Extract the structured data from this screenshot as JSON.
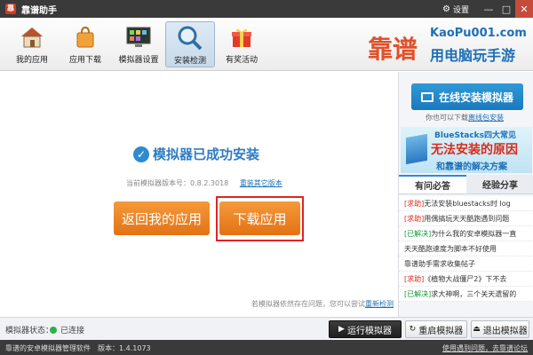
{
  "window": {
    "title": "靠谱助手",
    "settings_label": "设置"
  },
  "toolbar": {
    "items": [
      {
        "label": "我的应用",
        "icon": "house-icon"
      },
      {
        "label": "应用下载",
        "icon": "shopping-bag-icon"
      },
      {
        "label": "模拟器设置",
        "icon": "monitor-grid-icon"
      },
      {
        "label": "安装检测",
        "icon": "magnifier-icon",
        "active": true
      },
      {
        "label": "有奖活动",
        "icon": "gift-icon"
      }
    ]
  },
  "brand": {
    "logo_text": "靠谱",
    "site": "KaoPu001.com",
    "slogan": "用电脑玩手游"
  },
  "main": {
    "success_text": "模拟器已成功安装",
    "version_prefix": "当前模拟器版本号：",
    "version": "0.8.2.3018",
    "reinstall_link": "重装其它版本",
    "back_button": "返回我的应用",
    "download_button": "下载应用",
    "problem_text": "若模拟器依然存在问题，您可以尝试",
    "redetect_link": "重新检测"
  },
  "side": {
    "online_install_button": "在线安装模拟器",
    "online_hint": "你也可以下载",
    "offline_link": "离线包安装",
    "banner": {
      "line1": "BlueStacks四大常见",
      "line2": "无法安装的原因",
      "line3": "和靠谱的解决方案"
    },
    "tabs": [
      "有问必答",
      "经验分享"
    ],
    "news": [
      {
        "tag": "[求助]",
        "type": "q",
        "text": "无法安装bluestacks时 log"
      },
      {
        "tag": "[求助]",
        "type": "q",
        "text": "用偶搞玩天天酷跑遇到问题"
      },
      {
        "tag": "[已解决]",
        "type": "s",
        "text": "为什么我的安卓模拟器一直"
      },
      {
        "tag": "",
        "type": "n",
        "text": "天天酷跑速度为脚本不好使用"
      },
      {
        "tag": "",
        "type": "n",
        "text": "靠谱助手需求收集帖子"
      },
      {
        "tag": "[求助]",
        "type": "q",
        "text": "《植物大战僵尸2》下不去"
      },
      {
        "tag": "[已解决]",
        "type": "s",
        "text": "求大神啊，三个关天遗留的"
      }
    ]
  },
  "statusbar": {
    "label": "模拟器状态：",
    "status": "已连接",
    "run_button": "运行模拟器",
    "restart_button": "重启模拟器",
    "exit_button": "退出模拟器"
  },
  "bottombar": {
    "left": "靠谱的安卓模拟器管理软件",
    "version": "版本：1.4.1073",
    "right": "使用遇到问题，去靠谱论坛"
  },
  "colors": {
    "accent_blue": "#2f8ad2",
    "orange": "#e37214",
    "brand_red": "#e2502a",
    "highlight_red": "#e02323"
  }
}
